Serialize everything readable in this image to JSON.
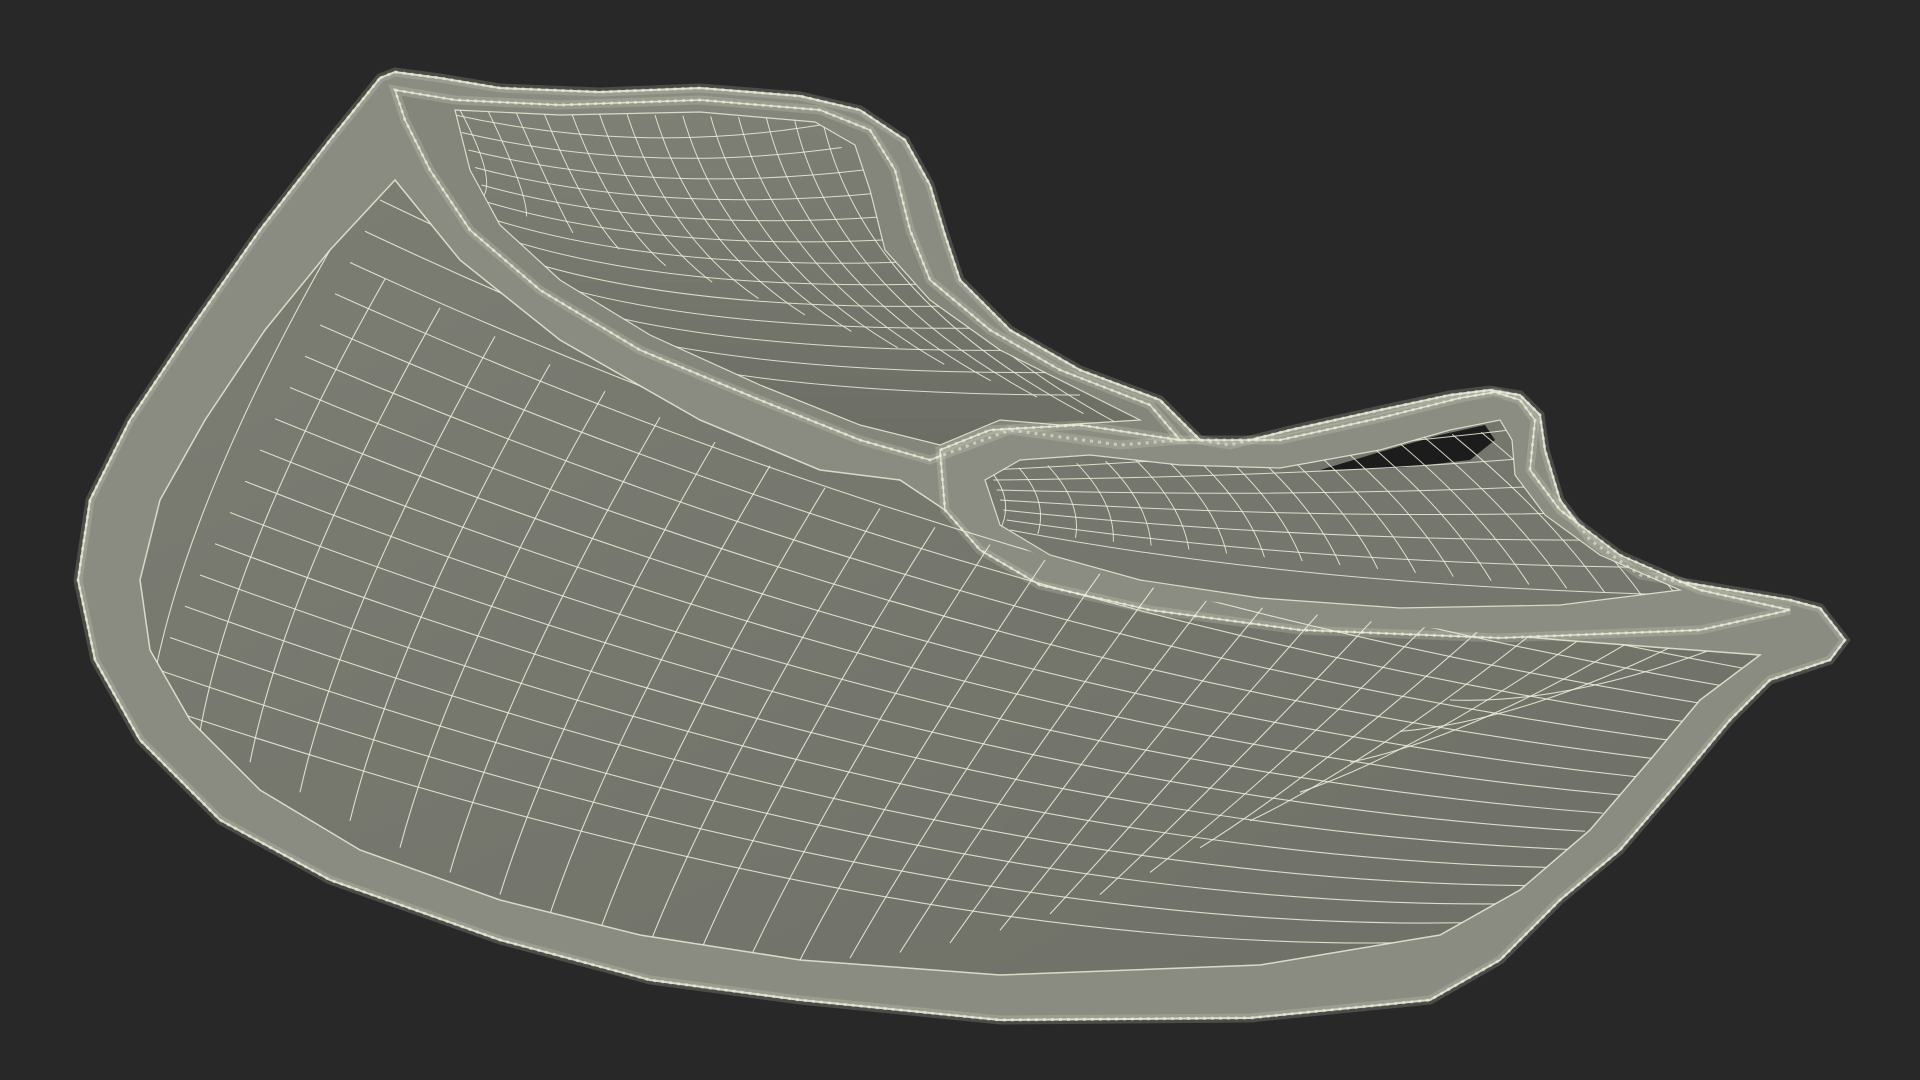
{
  "scene": {
    "background_color": "#282828",
    "surface_color": "#777970",
    "surface_shadow_color": "#6a6c63",
    "rim_color": "#8e9085",
    "rim_light_color": "#a3a597",
    "wire_color": "#eef0dc",
    "cavity_color": "#1c1c1c",
    "render_style": "wireframe-on-shaded",
    "subject": "3d-mesh-model"
  }
}
